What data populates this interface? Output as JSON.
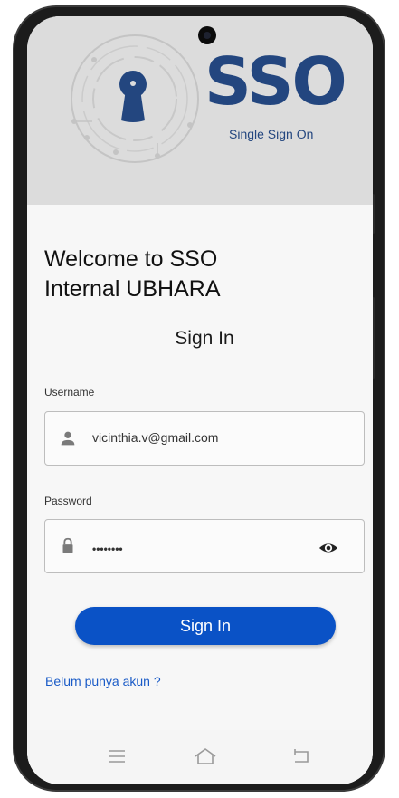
{
  "logo": {
    "brand": "SSO",
    "subtitle": "Single Sign On",
    "brand_color": "#23467f"
  },
  "welcome": {
    "line1": "Welcome to SSO",
    "line2": "Internal UBHARA"
  },
  "form": {
    "heading": "Sign In",
    "username": {
      "label": "Username",
      "value": "vicinthia.v@gmail.com",
      "icon": "person-icon"
    },
    "password": {
      "label": "Password",
      "value": "••••••••",
      "icon": "lock-icon",
      "toggle_icon": "eye-icon"
    },
    "submit_label": "Sign In",
    "register_link": "Belum punya akun ?"
  },
  "colors": {
    "primary_button": "#0a52c6",
    "link": "#1a5bc7",
    "header_bg": "#dcdcdc"
  },
  "navbar": {
    "icons": [
      "menu-icon",
      "home-icon",
      "back-icon"
    ]
  }
}
